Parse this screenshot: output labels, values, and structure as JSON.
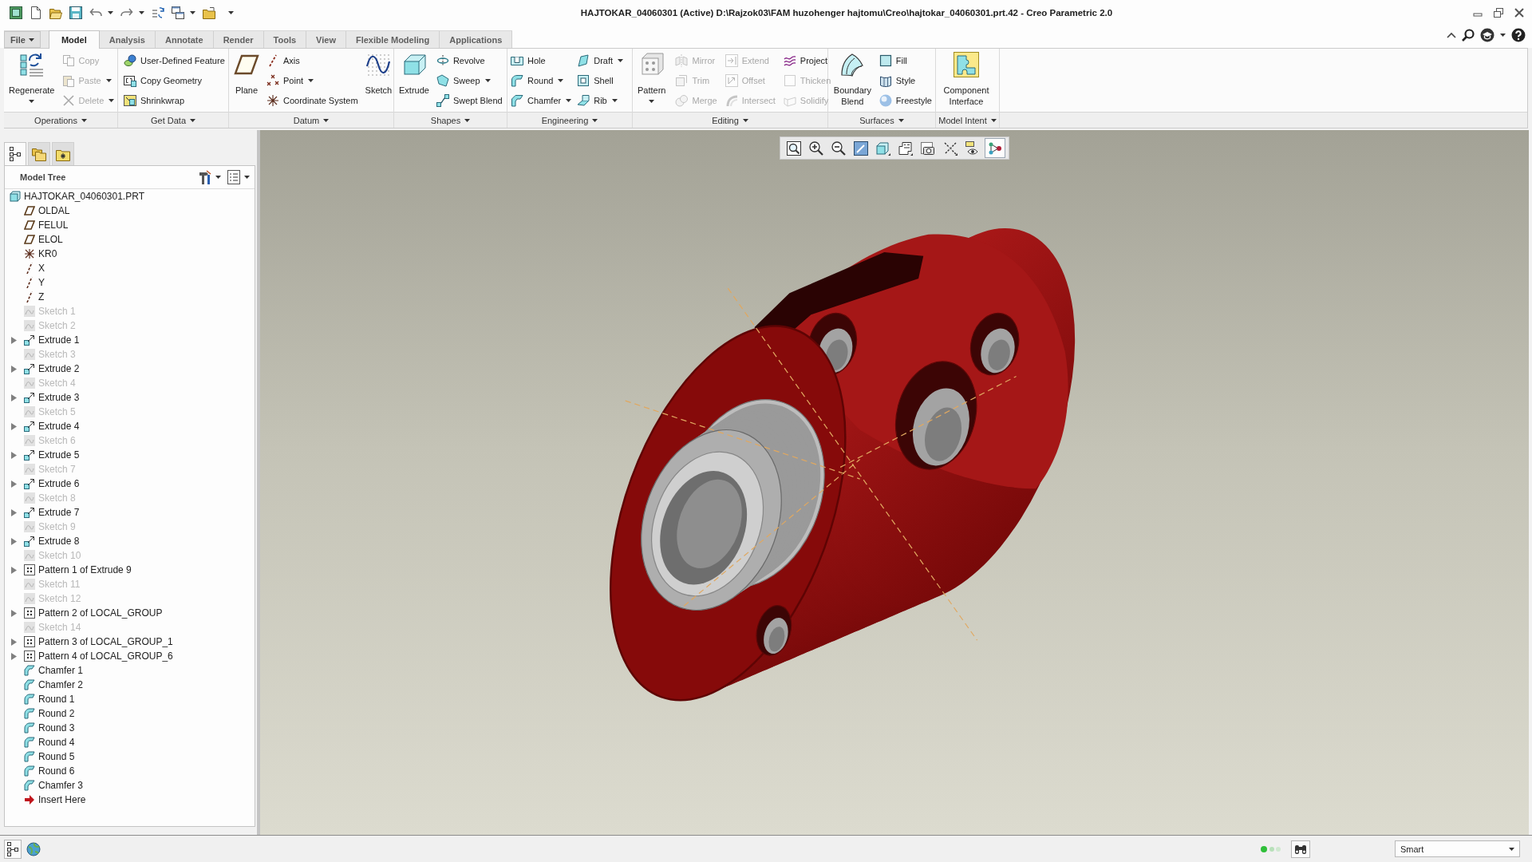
{
  "window": {
    "title": "HAJTOKAR_04060301 (Active) D:\\Rajzok03\\FAM huzohenger hajtomu\\Creo\\hajtokar_04060301.prt.42 - Creo Parametric 2.0"
  },
  "tabs": [
    {
      "label": "File",
      "kind": "menu",
      "selected": false
    },
    {
      "label": "Model",
      "kind": "tab",
      "selected": true
    },
    {
      "label": "Analysis",
      "kind": "tab",
      "selected": false
    },
    {
      "label": "Annotate",
      "kind": "tab",
      "selected": false
    },
    {
      "label": "Render",
      "kind": "tab",
      "selected": false
    },
    {
      "label": "Tools",
      "kind": "tab",
      "selected": false
    },
    {
      "label": "View",
      "kind": "tab",
      "selected": false
    },
    {
      "label": "Flexible Modeling",
      "kind": "tab",
      "selected": false
    },
    {
      "label": "Applications",
      "kind": "tab",
      "selected": false
    }
  ],
  "ribbon": {
    "groups": [
      {
        "label": "Operations",
        "items": [
          {
            "kind": "large",
            "label": "Regenerate",
            "dropdown": true,
            "disabled": false
          },
          {
            "kind": "column",
            "tools": [
              {
                "label": "Copy",
                "dropdown": false,
                "disabled": true
              },
              {
                "label": "Paste",
                "dropdown": true,
                "disabled": true
              },
              {
                "label": "Delete",
                "dropdown": true,
                "disabled": true
              }
            ]
          }
        ]
      },
      {
        "label": "Get Data",
        "items": [
          {
            "kind": "column",
            "tools": [
              {
                "label": "User-Defined Feature",
                "dropdown": false,
                "disabled": false
              },
              {
                "label": "Copy Geometry",
                "dropdown": false,
                "disabled": false
              },
              {
                "label": "Shrinkwrap",
                "dropdown": false,
                "disabled": false
              }
            ]
          }
        ]
      },
      {
        "label": "Datum",
        "items": [
          {
            "kind": "large",
            "label": "Plane",
            "dropdown": false,
            "disabled": false
          },
          {
            "kind": "column",
            "tools": [
              {
                "label": "Axis",
                "dropdown": false,
                "disabled": false
              },
              {
                "label": "Point",
                "dropdown": true,
                "disabled": false
              },
              {
                "label": "Coordinate System",
                "dropdown": false,
                "disabled": false
              }
            ]
          },
          {
            "kind": "large",
            "label": "Sketch",
            "dropdown": false,
            "disabled": false
          }
        ]
      },
      {
        "label": "Shapes",
        "items": [
          {
            "kind": "large",
            "label": "Extrude",
            "dropdown": false,
            "disabled": false
          },
          {
            "kind": "column",
            "tools": [
              {
                "label": "Revolve",
                "dropdown": false,
                "disabled": false
              },
              {
                "label": "Sweep",
                "dropdown": true,
                "disabled": false
              },
              {
                "label": "Swept Blend",
                "dropdown": false,
                "disabled": false
              }
            ]
          }
        ]
      },
      {
        "label": "Engineering",
        "items": [
          {
            "kind": "column",
            "tools": [
              {
                "label": "Hole",
                "dropdown": false,
                "disabled": false
              },
              {
                "label": "Round",
                "dropdown": true,
                "disabled": false
              },
              {
                "label": "Chamfer",
                "dropdown": true,
                "disabled": false
              }
            ]
          },
          {
            "kind": "column",
            "tools": [
              {
                "label": "Draft",
                "dropdown": true,
                "disabled": false
              },
              {
                "label": "Shell",
                "dropdown": false,
                "disabled": false
              },
              {
                "label": "Rib",
                "dropdown": true,
                "disabled": false
              }
            ]
          }
        ]
      },
      {
        "label": "Editing",
        "items": [
          {
            "kind": "large",
            "label": "Pattern",
            "dropdown": true,
            "disabled": false
          },
          {
            "kind": "column",
            "tools": [
              {
                "label": "Mirror",
                "dropdown": false,
                "disabled": true
              },
              {
                "label": "Trim",
                "dropdown": false,
                "disabled": true
              },
              {
                "label": "Merge",
                "dropdown": false,
                "disabled": true
              }
            ]
          },
          {
            "kind": "column",
            "tools": [
              {
                "label": "Extend",
                "dropdown": false,
                "disabled": true
              },
              {
                "label": "Offset",
                "dropdown": false,
                "disabled": true
              },
              {
                "label": "Intersect",
                "dropdown": false,
                "disabled": true
              }
            ]
          },
          {
            "kind": "column",
            "tools": [
              {
                "label": "Project",
                "dropdown": false,
                "disabled": false
              },
              {
                "label": "Thicken",
                "dropdown": false,
                "disabled": true
              },
              {
                "label": "Solidify",
                "dropdown": false,
                "disabled": true
              }
            ]
          }
        ]
      },
      {
        "label": "Surfaces",
        "items": [
          {
            "kind": "large",
            "label": "Boundary Blend",
            "dropdown": false,
            "disabled": false
          },
          {
            "kind": "column",
            "tools": [
              {
                "label": "Fill",
                "dropdown": false,
                "disabled": false
              },
              {
                "label": "Style",
                "dropdown": false,
                "disabled": false
              },
              {
                "label": "Freestyle",
                "dropdown": false,
                "disabled": false
              }
            ]
          }
        ]
      },
      {
        "label": "Model Intent",
        "items": [
          {
            "kind": "large",
            "label": "Component Interface",
            "dropdown": false,
            "disabled": false
          }
        ]
      }
    ]
  },
  "navigator": {
    "tabs": [
      {
        "selected": true
      },
      {
        "selected": false
      },
      {
        "selected": false
      }
    ]
  },
  "model_tree": {
    "title": "Model Tree",
    "root": {
      "label": "HAJTOKAR_04060301.PRT",
      "kind": "part",
      "dimmed": false,
      "children": [
        {
          "label": "OLDAL",
          "kind": "plane",
          "dimmed": false,
          "collapsed": false
        },
        {
          "label": "FELUL",
          "kind": "plane",
          "dimmed": false,
          "collapsed": false
        },
        {
          "label": "ELOL",
          "kind": "plane",
          "dimmed": false,
          "collapsed": false
        },
        {
          "label": "KR0",
          "kind": "csys",
          "dimmed": false,
          "collapsed": false
        },
        {
          "label": "X",
          "kind": "axis",
          "dimmed": false,
          "collapsed": false
        },
        {
          "label": "Y",
          "kind": "axis",
          "dimmed": false,
          "collapsed": false
        },
        {
          "label": "Z",
          "kind": "axis",
          "dimmed": false,
          "collapsed": false
        },
        {
          "label": "Sketch 1",
          "kind": "sketch",
          "dimmed": true,
          "collapsed": false
        },
        {
          "label": "Sketch 2",
          "kind": "sketch",
          "dimmed": true,
          "collapsed": false
        },
        {
          "label": "Extrude 1",
          "kind": "extrude",
          "dimmed": false,
          "collapsed": true
        },
        {
          "label": "Sketch 3",
          "kind": "sketch",
          "dimmed": true,
          "collapsed": false
        },
        {
          "label": "Extrude 2",
          "kind": "extrude",
          "dimmed": false,
          "collapsed": true
        },
        {
          "label": "Sketch 4",
          "kind": "sketch",
          "dimmed": true,
          "collapsed": false
        },
        {
          "label": "Extrude 3",
          "kind": "extrude",
          "dimmed": false,
          "collapsed": true
        },
        {
          "label": "Sketch 5",
          "kind": "sketch",
          "dimmed": true,
          "collapsed": false
        },
        {
          "label": "Extrude 4",
          "kind": "extrude",
          "dimmed": false,
          "collapsed": true
        },
        {
          "label": "Sketch 6",
          "kind": "sketch",
          "dimmed": true,
          "collapsed": false
        },
        {
          "label": "Extrude 5",
          "kind": "extrude",
          "dimmed": false,
          "collapsed": true
        },
        {
          "label": "Sketch 7",
          "kind": "sketch",
          "dimmed": true,
          "collapsed": false
        },
        {
          "label": "Extrude 6",
          "kind": "extrude",
          "dimmed": false,
          "collapsed": true
        },
        {
          "label": "Sketch 8",
          "kind": "sketch",
          "dimmed": true,
          "collapsed": false
        },
        {
          "label": "Extrude 7",
          "kind": "extrude",
          "dimmed": false,
          "collapsed": true
        },
        {
          "label": "Sketch 9",
          "kind": "sketch",
          "dimmed": true,
          "collapsed": false
        },
        {
          "label": "Extrude 8",
          "kind": "extrude",
          "dimmed": false,
          "collapsed": true
        },
        {
          "label": "Sketch 10",
          "kind": "sketch",
          "dimmed": true,
          "collapsed": false
        },
        {
          "label": "Pattern 1 of Extrude 9",
          "kind": "pattern",
          "dimmed": false,
          "collapsed": true
        },
        {
          "label": "Sketch 11",
          "kind": "sketch",
          "dimmed": true,
          "collapsed": false
        },
        {
          "label": "Sketch 12",
          "kind": "sketch",
          "dimmed": true,
          "collapsed": false
        },
        {
          "label": "Pattern 2 of LOCAL_GROUP",
          "kind": "pattern",
          "dimmed": false,
          "collapsed": true
        },
        {
          "label": "Sketch 14",
          "kind": "sketch",
          "dimmed": true,
          "collapsed": false
        },
        {
          "label": "Pattern 3 of LOCAL_GROUP_1",
          "kind": "pattern",
          "dimmed": false,
          "collapsed": true
        },
        {
          "label": "Pattern 4 of LOCAL_GROUP_6",
          "kind": "pattern",
          "dimmed": false,
          "collapsed": true
        },
        {
          "label": "Chamfer 1",
          "kind": "chamfer",
          "dimmed": false,
          "collapsed": false
        },
        {
          "label": "Chamfer 2",
          "kind": "chamfer",
          "dimmed": false,
          "collapsed": false
        },
        {
          "label": "Round 1",
          "kind": "round",
          "dimmed": false,
          "collapsed": false
        },
        {
          "label": "Round 2",
          "kind": "round",
          "dimmed": false,
          "collapsed": false
        },
        {
          "label": "Round 3",
          "kind": "round",
          "dimmed": false,
          "collapsed": false
        },
        {
          "label": "Round 4",
          "kind": "round",
          "dimmed": false,
          "collapsed": false
        },
        {
          "label": "Round 5",
          "kind": "round",
          "dimmed": false,
          "collapsed": false
        },
        {
          "label": "Round 6",
          "kind": "round",
          "dimmed": false,
          "collapsed": false
        },
        {
          "label": "Chamfer 3",
          "kind": "chamfer",
          "dimmed": false,
          "collapsed": false
        },
        {
          "label": "Insert Here",
          "kind": "insert",
          "dimmed": false,
          "collapsed": false
        }
      ]
    }
  },
  "graphics_toolbar": [
    {
      "selected": false
    },
    {
      "selected": false
    },
    {
      "selected": false
    },
    {
      "selected": false
    },
    {
      "selected": false
    },
    {
      "selected": false
    },
    {
      "selected": false
    },
    {
      "selected": false
    },
    {
      "selected": false
    },
    {
      "selected": true
    }
  ],
  "status_bar": {
    "panes": [
      {
        "selected": true
      },
      {
        "selected": false
      }
    ],
    "selection_filter": "Smart"
  }
}
